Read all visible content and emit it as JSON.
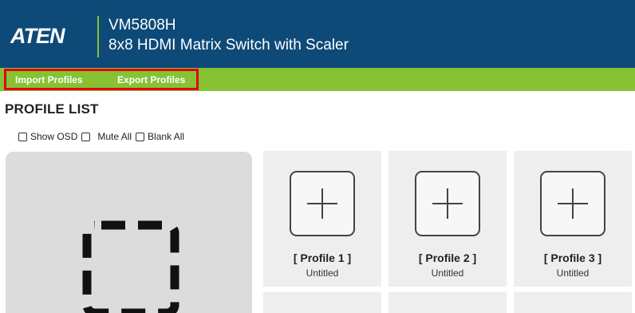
{
  "header": {
    "brand": "ATEN",
    "model": "VM5808H",
    "subtitle": "8x8 HDMI Matrix Switch with Scaler"
  },
  "menu": {
    "import_label": "Import Profiles",
    "export_label": "Export Profiles"
  },
  "section_title": "PROFILE LIST",
  "options": {
    "show_osd": "Show OSD",
    "mute_all": "Mute All",
    "blank_all": "Blank All"
  },
  "profiles": [
    {
      "name": "[ Profile 1 ]",
      "desc": "Untitled"
    },
    {
      "name": "[ Profile 2 ]",
      "desc": "Untitled"
    },
    {
      "name": "[ Profile 3 ]",
      "desc": "Untitled"
    }
  ],
  "colors": {
    "header_bg": "#0d4a78",
    "menu_bg": "#86c232",
    "highlight": "#e3000f"
  }
}
